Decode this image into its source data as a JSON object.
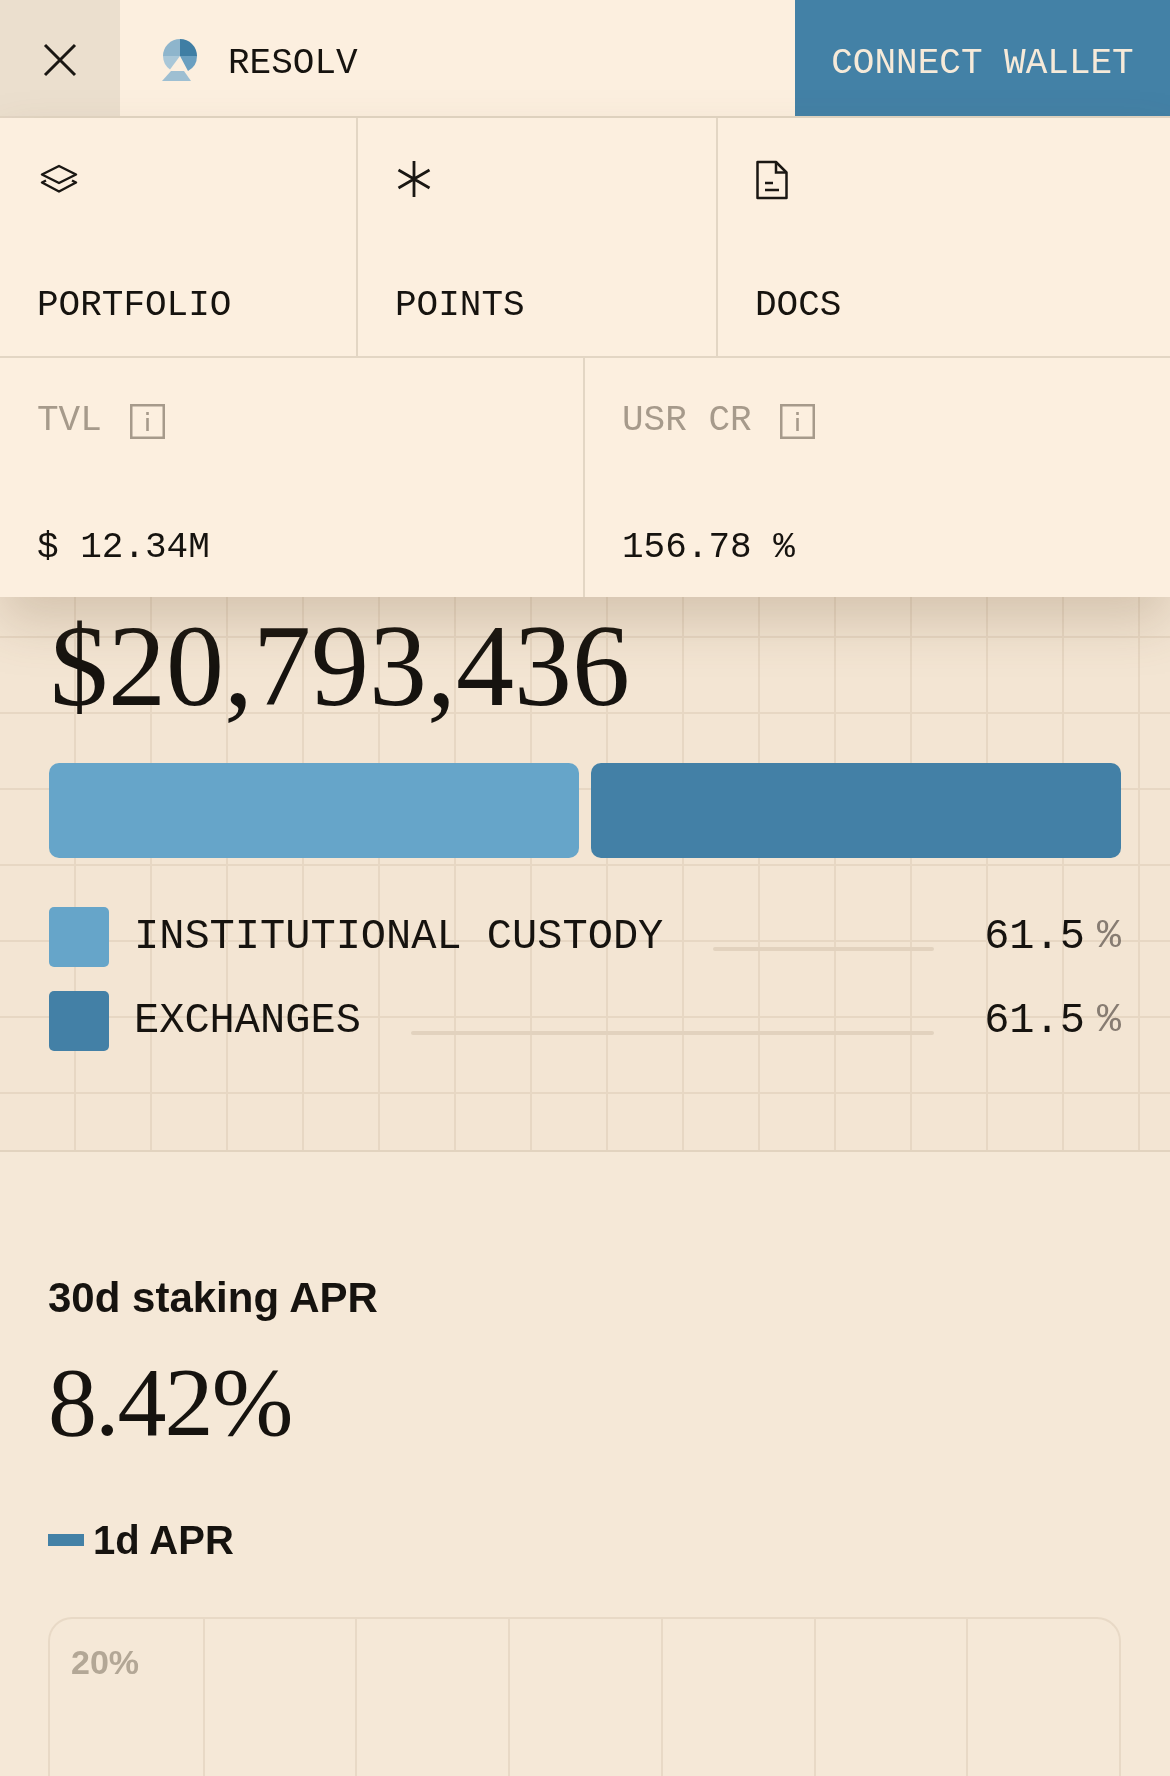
{
  "header": {
    "brand": "RESOLV",
    "connect_button": "CONNECT WALLET"
  },
  "menu": {
    "open": true,
    "nav_items": [
      {
        "label": "PORTFOLIO"
      },
      {
        "label": "POINTS"
      },
      {
        "label": "DOCS"
      }
    ],
    "stats": [
      {
        "label": "TVL",
        "value": "$ 12.34M"
      },
      {
        "label": "USR CR",
        "value": "156.78 %"
      }
    ]
  },
  "allocation": {
    "total": "$20,793,436",
    "items": [
      {
        "label": "INSTITUTIONAL CUSTODY",
        "value": "61.5",
        "unit": "%",
        "color": "#66a5c9"
      },
      {
        "label": "EXCHANGES",
        "value": "61.5",
        "unit": "%",
        "color": "#4380a6"
      }
    ]
  },
  "staking": {
    "title": "30d staking APR",
    "value": "8.42%",
    "legend_label": "1d APR",
    "tick_label": "20%"
  }
}
